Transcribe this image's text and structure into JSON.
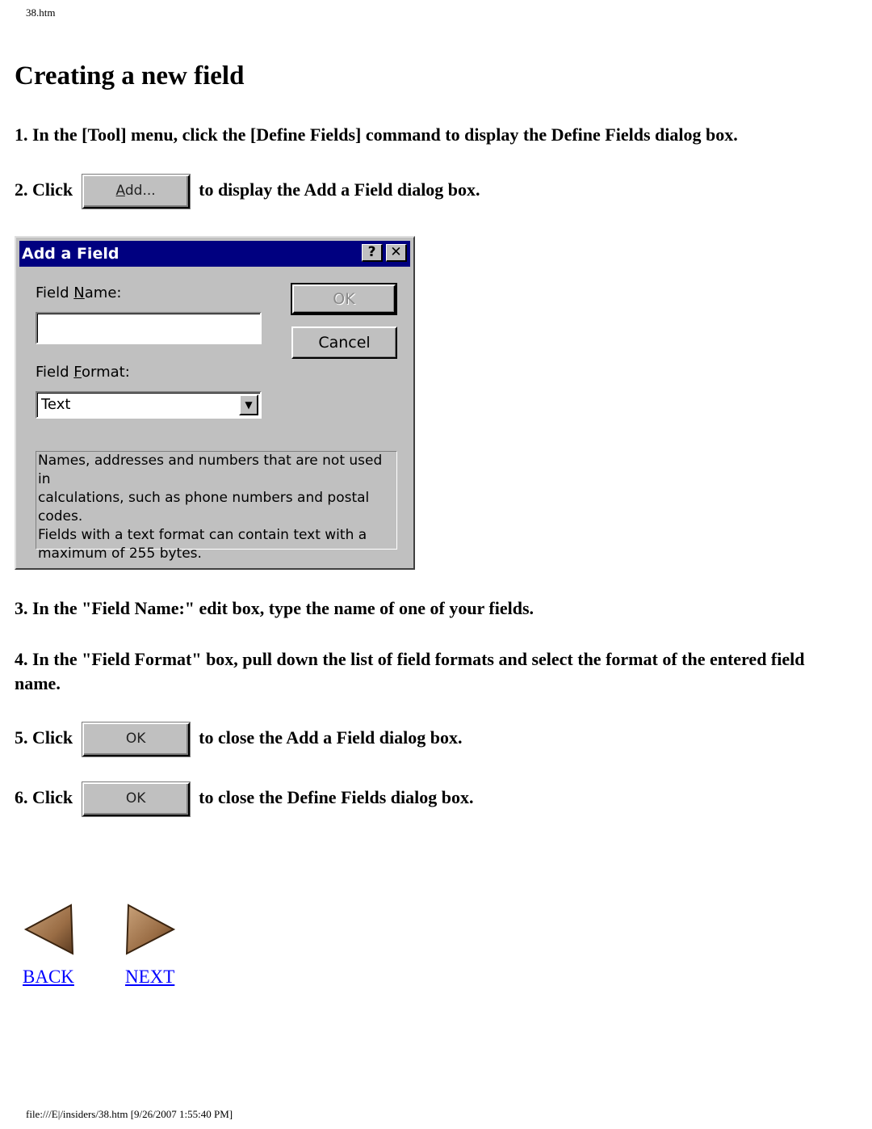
{
  "header": {
    "filename": "38.htm"
  },
  "page_title": "Creating a new field",
  "steps": [
    {
      "number": "1.",
      "text": "In the [Tool] menu, click the [Define Fields] command to display the Define Fields dialog box."
    },
    {
      "number": "2.",
      "prefix": "Click",
      "button_label": "Add...",
      "suffix": "to display the Add a Field dialog box."
    },
    {
      "number": "3.",
      "text": "In the \"Field Name:\" edit box, type the name of one of your fields."
    },
    {
      "number": "4.",
      "text": "In the \"Field Format\" box, pull down the list of field formats and select the format of the entered field name."
    },
    {
      "number": "5.",
      "prefix": "Click",
      "button_label": "OK",
      "suffix": "to close the Add a Field dialog box."
    },
    {
      "number": "6.",
      "prefix": "Click",
      "button_label": "OK",
      "suffix": "to close the Define Fields dialog box."
    }
  ],
  "dialog": {
    "title": "Add a Field",
    "help_button": "?",
    "close_button": "✕",
    "field_name_label_pre": "Field ",
    "field_name_label_accel": "N",
    "field_name_label_post": "ame:",
    "field_name_value": "",
    "field_format_label_pre": "Field ",
    "field_format_label_accel": "F",
    "field_format_label_post": "ormat:",
    "field_format_value": "Text",
    "ok_label": "OK",
    "cancel_label": "Cancel",
    "description_lines": [
      "Names, addresses and numbers that are not used in",
      "calculations, such as phone numbers and postal",
      "codes.",
      "Fields with a text format can contain text with a",
      "maximum of 255 bytes."
    ]
  },
  "nav": {
    "back_label": "BACK",
    "next_label": "NEXT",
    "link_color": "#0000ff"
  },
  "footer": {
    "text": "file:///E|/insiders/38.htm [9/26/2007 1:55:40 PM]"
  }
}
